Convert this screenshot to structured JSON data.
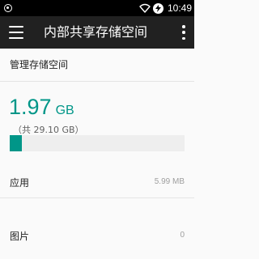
{
  "status_bar": {
    "time": "10:49",
    "left_icon": "sync-circle-icon",
    "icons": [
      "wifi-icon",
      "battery-charging-icon"
    ]
  },
  "app_bar": {
    "title": "内部共享存储空间",
    "menu_icon": "hamburger-menu-icon",
    "more_icon": "more-vert-icon"
  },
  "storage": {
    "section_title": "管理存储空间",
    "used_value": "1.97",
    "used_unit": "GB",
    "total_text": "（共 29.10 GB）",
    "used_fraction": 0.068,
    "accent_color": "#009688"
  },
  "categories": [
    {
      "label": "应用",
      "value": "5.99 MB"
    },
    {
      "label": "图片",
      "value": "0"
    }
  ]
}
